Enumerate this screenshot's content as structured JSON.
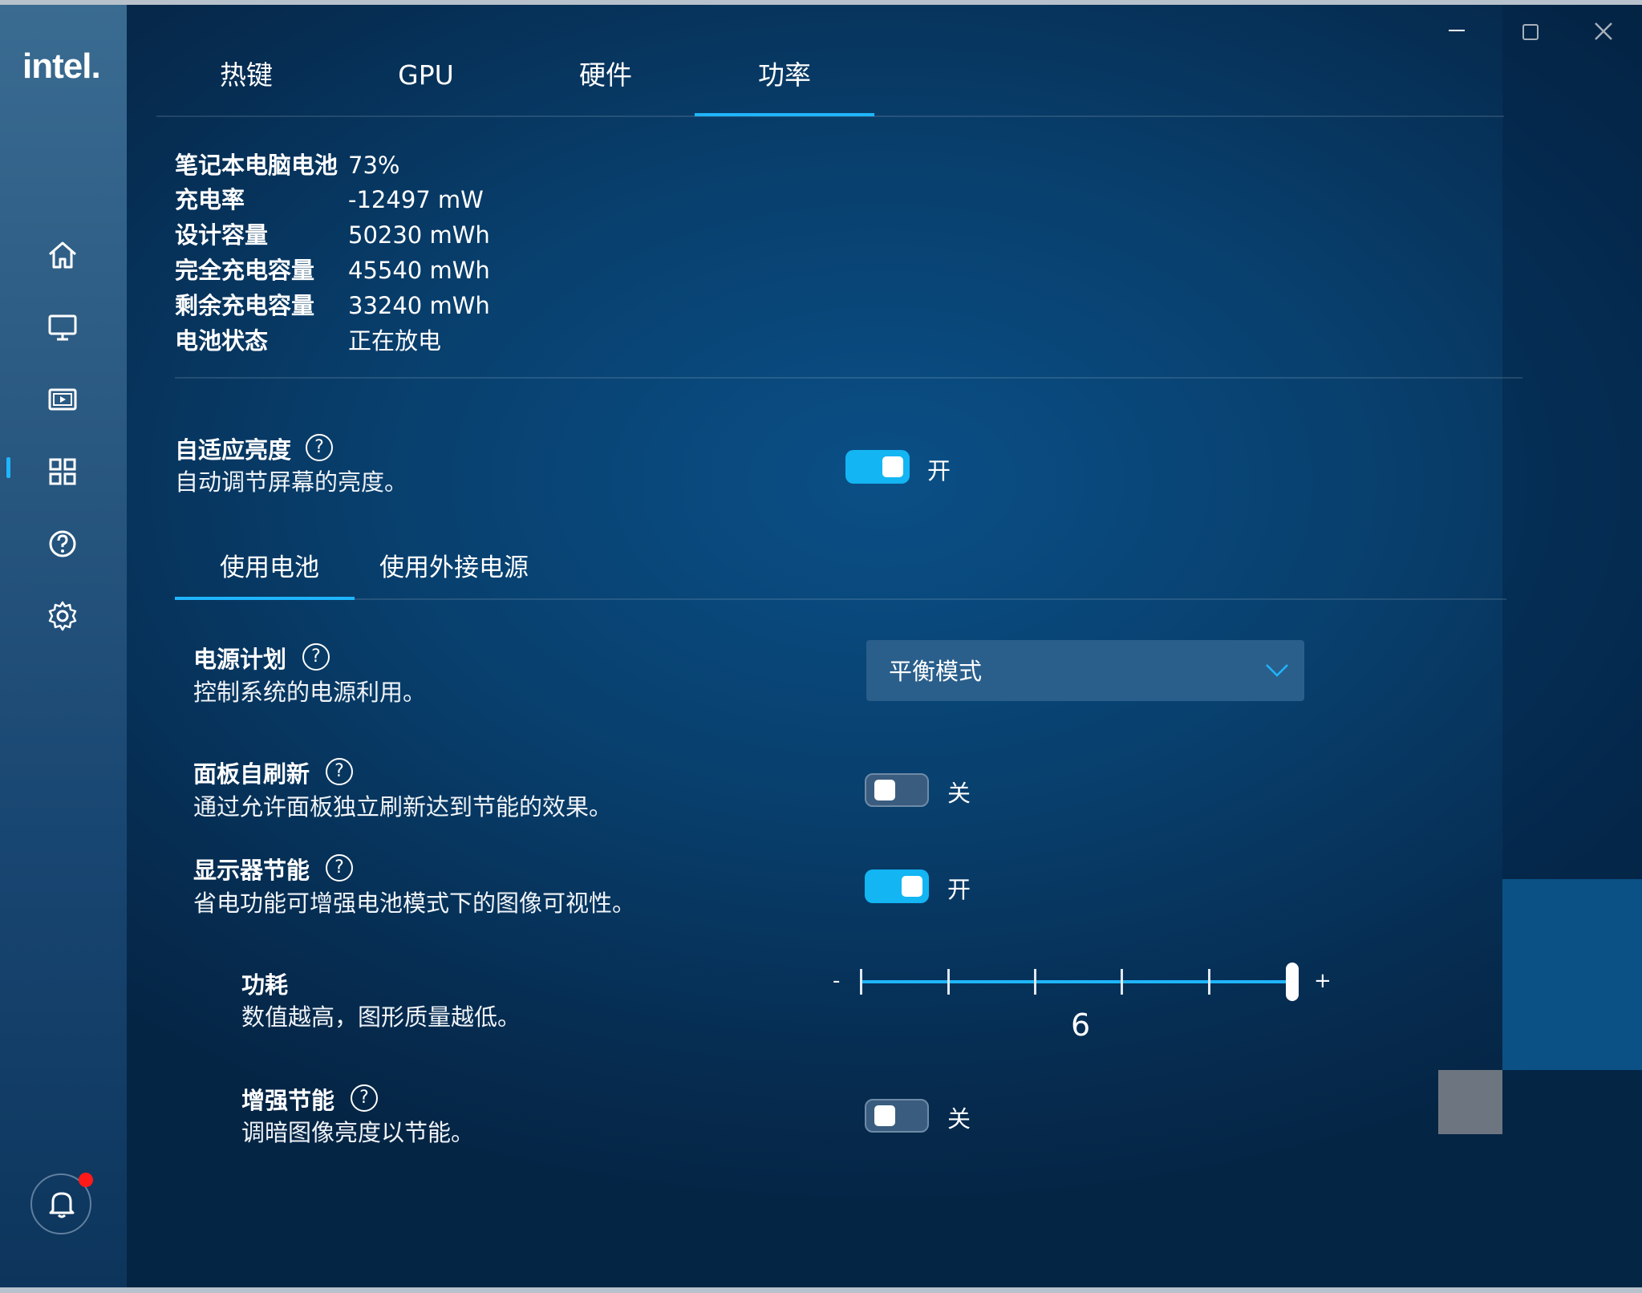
{
  "app": {
    "logo": "intel."
  },
  "tabs": [
    {
      "label": "热键"
    },
    {
      "label": "GPU"
    },
    {
      "label": "硬件"
    },
    {
      "label": "功率"
    }
  ],
  "battery_info": [
    {
      "label": "笔记本电脑电池",
      "value": "73%"
    },
    {
      "label": "充电率",
      "value": "-12497 mW"
    },
    {
      "label": "设计容量",
      "value": "50230 mWh"
    },
    {
      "label": "完全充电容量",
      "value": "45540 mWh"
    },
    {
      "label": "剩余充电容量",
      "value": "33240 mWh"
    },
    {
      "label": "电池状态",
      "value": "正在放电"
    }
  ],
  "adaptive_brightness": {
    "title": "自适应亮度",
    "desc": "自动调节屏幕的亮度。",
    "state": "开"
  },
  "subtabs": [
    {
      "label": "使用电池"
    },
    {
      "label": "使用外接电源"
    }
  ],
  "power_plan": {
    "title": "电源计划",
    "desc": "控制系统的电源利用。",
    "selected": "平衡模式"
  },
  "panel_self_refresh": {
    "title": "面板自刷新",
    "desc": "通过允许面板独立刷新达到节能的效果。",
    "state": "关"
  },
  "display_power_saving": {
    "title": "显示器节能",
    "desc": "省电功能可增强电池模式下的图像可视性。",
    "state": "开"
  },
  "power_consumption": {
    "title": "功耗",
    "desc": "数值越高，图形质量越低。",
    "min_label": "-",
    "max_label": "+",
    "value": "6"
  },
  "enhanced_saving": {
    "title": "增强节能",
    "desc": "调暗图像亮度以节能。",
    "state": "关"
  },
  "help_symbol": "?",
  "colors": {
    "accent": "#1fb5ff",
    "toggle_on": "#13b5f2",
    "notification_dot": "#ff1a1a"
  }
}
